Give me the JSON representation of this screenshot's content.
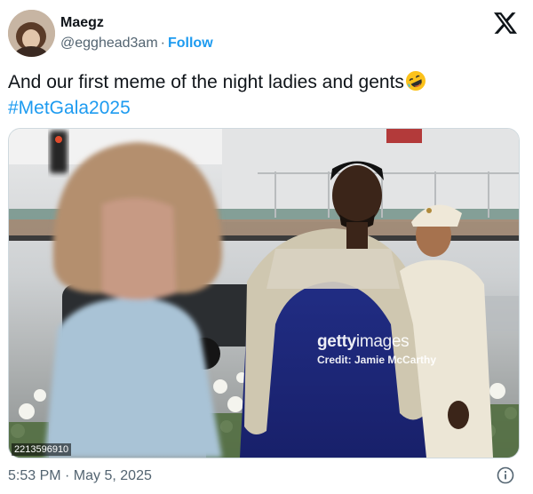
{
  "author": {
    "name": "Maegz",
    "handle": "@egghead3am",
    "separator": "·",
    "follow_label": "Follow"
  },
  "brand_icon": "x-logo-icon",
  "tweet": {
    "text": "And our first meme of the night ladies and gents",
    "emoji": "rolling-on-the-floor-laughing-emoji",
    "hashtag": "#MetGala2025"
  },
  "media": {
    "watermark_logo_bold": "getty",
    "watermark_logo_light": "images",
    "credit": "Credit: Jamie McCarthy",
    "image_id": "2213596910"
  },
  "meta": {
    "timestamp": "5:53 PM · May 5, 2025",
    "info_icon": "info-icon"
  },
  "colors": {
    "link": "#1d9bf0",
    "text": "#0f1419",
    "secondary": "#536471"
  }
}
